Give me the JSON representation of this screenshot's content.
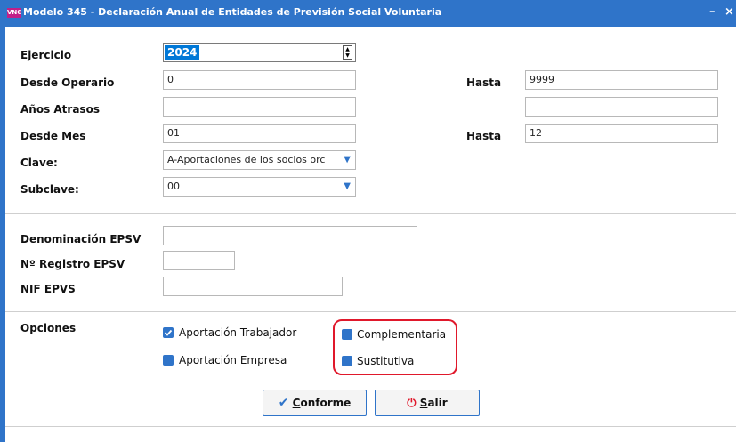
{
  "window": {
    "title": "Modelo 345 - Declaración Anual de Entidades de Previsión Social Voluntaria",
    "app_icon_text": "VNC",
    "minimize_symbol": "–",
    "close_symbol": "×"
  },
  "fields": {
    "ejercicio": {
      "label": "Ejercicio",
      "value": "2024"
    },
    "desde_operario": {
      "label": "Desde Operario",
      "value": "0"
    },
    "hasta_operario": {
      "label": "Hasta",
      "value": "9999"
    },
    "anos_atrasos": {
      "label": "Años Atrasos",
      "value": "",
      "value2": ""
    },
    "desde_mes": {
      "label": "Desde Mes",
      "value": "01"
    },
    "hasta_mes": {
      "label": "Hasta",
      "value": "12"
    },
    "clave": {
      "label": "Clave:",
      "value": "A-Aportaciones de los socios orc"
    },
    "subclave": {
      "label": "Subclave:",
      "value": "00"
    },
    "denominacion": {
      "label": "Denominación EPSV",
      "value": ""
    },
    "registro": {
      "label": "Nº Registro EPSV",
      "value": ""
    },
    "nif": {
      "label": "NIF EPVS",
      "value": ""
    }
  },
  "options": {
    "label": "Opciones",
    "items": [
      {
        "label": "Aportación Trabajador",
        "checked": true
      },
      {
        "label": "Aportación Empresa",
        "checked": false
      },
      {
        "label": "Complementaria",
        "checked": false
      },
      {
        "label": "Sustitutiva",
        "checked": false
      }
    ]
  },
  "buttons": {
    "conforme": {
      "underline": "C",
      "rest": "onforme"
    },
    "salir": {
      "underline": "S",
      "rest": "alir"
    }
  },
  "colors": {
    "accent": "#2f74c9",
    "highlight": "#e0182b",
    "title_bar": "#2f74c9"
  }
}
